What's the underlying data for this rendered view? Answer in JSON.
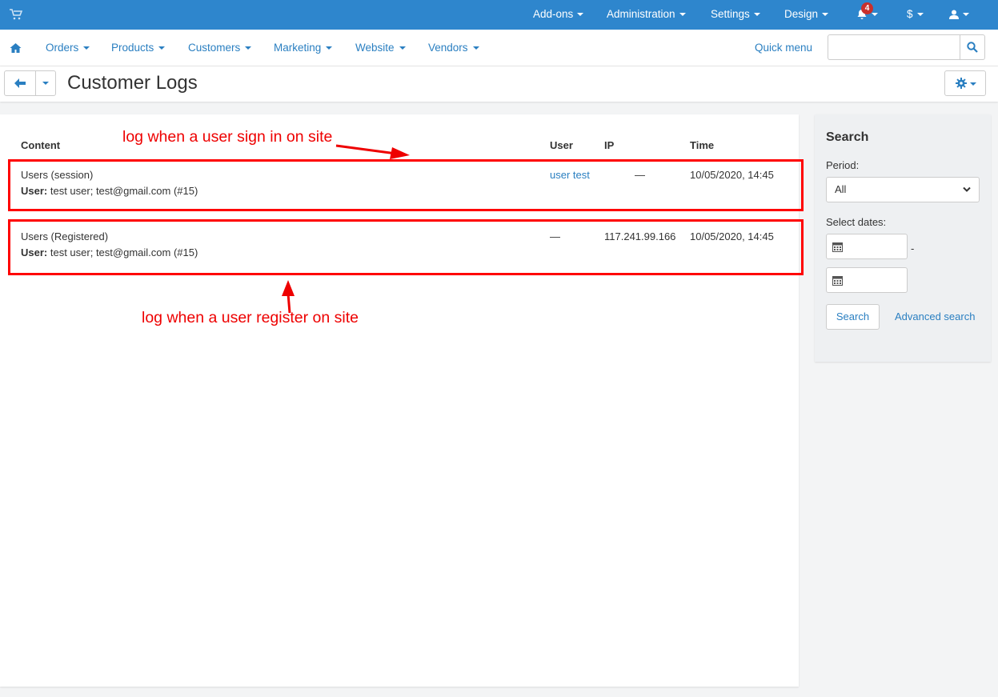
{
  "topbar": {
    "items": [
      {
        "label": "Add-ons"
      },
      {
        "label": "Administration"
      },
      {
        "label": "Settings"
      },
      {
        "label": "Design"
      }
    ],
    "notifications_count": "4",
    "currency_label": "$"
  },
  "nav": {
    "items": [
      {
        "label": "Orders"
      },
      {
        "label": "Products"
      },
      {
        "label": "Customers"
      },
      {
        "label": "Marketing"
      },
      {
        "label": "Website"
      },
      {
        "label": "Vendors"
      }
    ],
    "quick_menu": "Quick menu",
    "search_placeholder": ""
  },
  "page": {
    "title": "Customer Logs"
  },
  "table": {
    "headers": {
      "content": "Content",
      "user": "User",
      "ip": "IP",
      "time": "Time"
    },
    "rows": [
      {
        "content": "Users (session)",
        "detail_label": "User:",
        "detail": " test user; test@gmail.com (#15)",
        "user": "user test",
        "ip": "—",
        "time": "10/05/2020, 14:45"
      },
      {
        "content": "Users (Registered)",
        "detail_label": "User:",
        "detail": " test user; test@gmail.com (#15)",
        "user": "—",
        "ip": "117.241.99.166",
        "time": "10/05/2020, 14:45"
      }
    ]
  },
  "annotations": {
    "signin": "log when a user sign in on site",
    "register": "log when a user register on site"
  },
  "sidebar": {
    "title": "Search",
    "period_label": "Period:",
    "period_value": "All",
    "dates_label": "Select dates:",
    "date_separator": "-",
    "search_button": "Search",
    "advanced_link": "Advanced search"
  },
  "colors": {
    "topbar": "#2e86cd",
    "link": "#2a7fc1",
    "annotation": "#ff0000",
    "badge": "#c9302c"
  }
}
